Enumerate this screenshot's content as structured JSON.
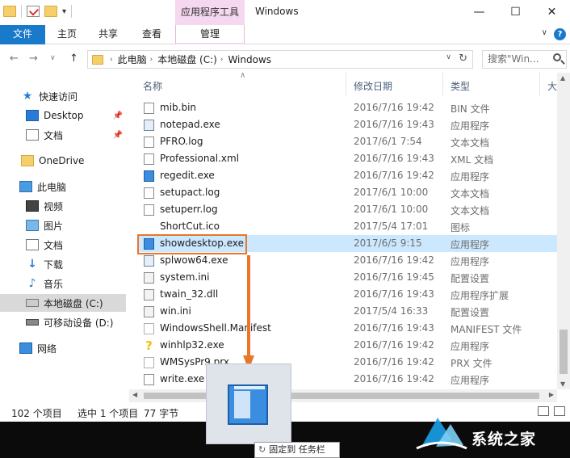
{
  "window": {
    "title": "Windows",
    "context_tab_title": "应用程序工具",
    "controls": {
      "minimize": "—",
      "maximize": "☐",
      "close": "✕"
    }
  },
  "ribbon": {
    "tabs": [
      "文件",
      "主页",
      "共享",
      "查看",
      "管理"
    ],
    "help": "?"
  },
  "address": {
    "crumbs": [
      "此电脑",
      "本地磁盘 (C:)",
      "Windows"
    ],
    "search_placeholder": "搜索\"Win..."
  },
  "nav": {
    "items": [
      {
        "label": "快速访问",
        "icon": "quick-access-star-icon",
        "pinned": false,
        "selected": false
      },
      {
        "label": "Desktop",
        "icon": "desktop-icon",
        "pinned": true,
        "selected": false
      },
      {
        "label": "文档",
        "icon": "documents-icon",
        "pinned": true,
        "selected": false
      },
      {
        "label": "OneDrive",
        "icon": "onedrive-folder-icon",
        "pinned": false,
        "selected": false
      },
      {
        "label": "此电脑",
        "icon": "this-pc-icon",
        "pinned": false,
        "selected": false
      },
      {
        "label": "视频",
        "icon": "videos-icon",
        "pinned": false,
        "selected": false
      },
      {
        "label": "图片",
        "icon": "pictures-icon",
        "pinned": false,
        "selected": false
      },
      {
        "label": "文档",
        "icon": "documents-icon",
        "pinned": false,
        "selected": false
      },
      {
        "label": "下载",
        "icon": "downloads-icon",
        "pinned": false,
        "selected": false
      },
      {
        "label": "音乐",
        "icon": "music-icon",
        "pinned": false,
        "selected": false
      },
      {
        "label": "本地磁盘 (C:)",
        "icon": "local-disk-icon",
        "pinned": false,
        "selected": true
      },
      {
        "label": "可移动设备 (D:)",
        "icon": "removable-drive-icon",
        "pinned": false,
        "selected": false
      },
      {
        "label": "网络",
        "icon": "network-icon",
        "pinned": false,
        "selected": false
      }
    ]
  },
  "columns": {
    "name": "名称",
    "modified": "修改日期",
    "type": "类型",
    "size": "大"
  },
  "files": [
    {
      "name": "mib.bin",
      "date": "2016/7/16 19:42",
      "type": "BIN 文件",
      "icon": "doc"
    },
    {
      "name": "notepad.exe",
      "date": "2016/7/16 19:43",
      "type": "应用程序",
      "icon": "exe"
    },
    {
      "name": "PFRO.log",
      "date": "2017/6/1 7:54",
      "type": "文本文档",
      "icon": "doc"
    },
    {
      "name": "Professional.xml",
      "date": "2016/7/16 19:43",
      "type": "XML 文档",
      "icon": "doc"
    },
    {
      "name": "regedit.exe",
      "date": "2016/7/16 19:42",
      "type": "应用程序",
      "icon": "exe2"
    },
    {
      "name": "setupact.log",
      "date": "2017/6/1 10:00",
      "type": "文本文档",
      "icon": "doc"
    },
    {
      "name": "setuperr.log",
      "date": "2017/6/1 10:00",
      "type": "文本文档",
      "icon": "doc"
    },
    {
      "name": "ShortCut.ico",
      "date": "2017/5/4 17:01",
      "type": "图标",
      "icon": "none"
    },
    {
      "name": "showdesktop.exe",
      "date": "2017/6/5 9:15",
      "type": "应用程序",
      "icon": "exe2",
      "selected": true
    },
    {
      "name": "splwow64.exe",
      "date": "2016/7/16 19:42",
      "type": "应用程序",
      "icon": "exe"
    },
    {
      "name": "system.ini",
      "date": "2016/7/16 19:45",
      "type": "配置设置",
      "icon": "gear"
    },
    {
      "name": "twain_32.dll",
      "date": "2016/7/16 19:43",
      "type": "应用程序扩展",
      "icon": "gear"
    },
    {
      "name": "win.ini",
      "date": "2017/5/4 16:33",
      "type": "配置设置",
      "icon": "gear"
    },
    {
      "name": "WindowsShell.Manifest",
      "date": "2016/7/16 19:43",
      "type": "MANIFEST 文件",
      "icon": "blank"
    },
    {
      "name": "winhlp32.exe",
      "date": "2016/7/16 19:42",
      "type": "应用程序",
      "icon": "help"
    },
    {
      "name": "WMSysPr9.prx",
      "date": "2016/7/16 19:42",
      "type": "PRX 文件",
      "icon": "blank"
    },
    {
      "name": "write.exe",
      "date": "2016/7/16 19:42",
      "type": "应用程序",
      "icon": "doc"
    }
  ],
  "status": {
    "count": "102 个项目",
    "selected": "选中 1 个项目",
    "size": "77 字节"
  },
  "taskbar": {
    "pin_tooltip": "固定到 任务栏"
  },
  "watermark": {
    "text": "系统之家"
  },
  "colors": {
    "accent": "#1979ca",
    "selection": "#cce8ff",
    "highlight_box": "#e8762b",
    "context_tab": "#f5d7f0"
  }
}
